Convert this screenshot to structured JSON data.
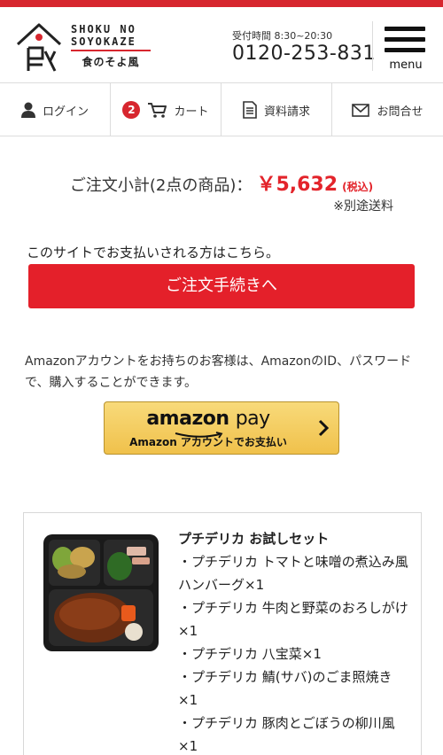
{
  "header": {
    "brand_en_line1": "SHOKU NO",
    "brand_en_line2": "SOYOKAZE",
    "brand_jp": "食のそよ風",
    "hours": "受付時間 8:30~20:30",
    "phone": "0120-253-831",
    "menu_label": "menu"
  },
  "nav": {
    "login": "ログイン",
    "cart_count": "2",
    "cart": "カート",
    "brochure": "資料請求",
    "contact": "お問合せ"
  },
  "summary": {
    "label": "ご注文小計(2点の商品)：",
    "price": "￥5,632",
    "tax": "(税込)",
    "shipping_note": "※別途送料"
  },
  "checkout": {
    "note": "このサイトでお支払いされる方はこちら。",
    "button": "ご注文手続きへ"
  },
  "amazon": {
    "note": "Amazonアカウントをお持ちのお客様は、AmazonのID、パスワードで、購入することができます。",
    "logo_amazon": "amazon",
    "logo_pay": "pay",
    "button_sub": "Amazon アカウントでお支払い"
  },
  "product": {
    "name": "プチデリカ お試しセット",
    "items": [
      "・プチデリカ トマトと味噌の煮込み風ハンバーグ×1",
      "・プチデリカ 牛肉と野菜のおろしがけ×1",
      "・プチデリカ 八宝菜×1",
      "・プチデリカ 鯖(サバ)のごま照焼き×1",
      "・プチデリカ 豚肉とごぼうの柳川風×1"
    ]
  },
  "colors": {
    "accent_red": "#e4202a",
    "price_red": "#e3242b",
    "amazon_yellow": "#f0c14b"
  }
}
